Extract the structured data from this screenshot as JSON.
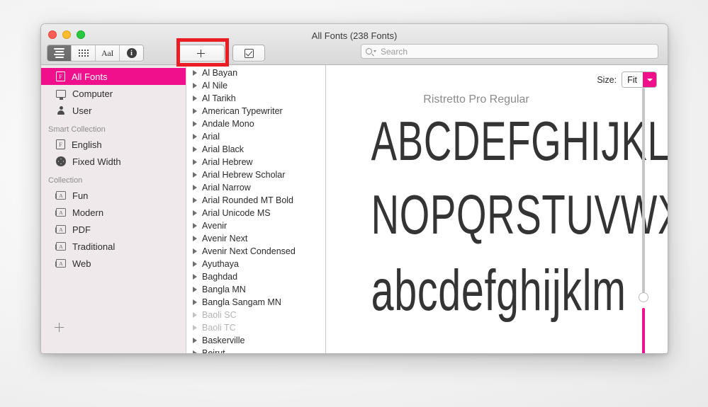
{
  "window": {
    "title": "All Fonts (238 Fonts)"
  },
  "toolbar": {
    "view_list_icon": "list-view-icon",
    "view_grid_icon": "grid-view-icon",
    "view_sample_label": "AaI",
    "info_label": "i",
    "add_label": "+",
    "validate_label": "validate-checkbox-icon"
  },
  "search": {
    "placeholder": "Search"
  },
  "sidebar": {
    "items": [
      {
        "label": "All Fonts",
        "icon": "book-icon",
        "selected": true
      },
      {
        "label": "Computer",
        "icon": "computer-icon",
        "selected": false
      },
      {
        "label": "User",
        "icon": "user-icon",
        "selected": false
      }
    ],
    "smart_collection_header": "Smart Collection",
    "smart_items": [
      {
        "label": "English",
        "icon": "book-icon"
      },
      {
        "label": "Fixed Width",
        "icon": "gear-icon"
      }
    ],
    "collection_header": "Collection",
    "collection_items": [
      {
        "label": "Fun",
        "icon": "collection-icon"
      },
      {
        "label": "Modern",
        "icon": "collection-icon"
      },
      {
        "label": "PDF",
        "icon": "collection-icon"
      },
      {
        "label": "Traditional",
        "icon": "collection-icon"
      },
      {
        "label": "Web",
        "icon": "collection-icon"
      }
    ],
    "add_label": "+"
  },
  "font_list": [
    {
      "name": "Al Bayan",
      "disabled": false
    },
    {
      "name": "Al Nile",
      "disabled": false
    },
    {
      "name": "Al Tarikh",
      "disabled": false
    },
    {
      "name": "American Typewriter",
      "disabled": false
    },
    {
      "name": "Andale Mono",
      "disabled": false
    },
    {
      "name": "Arial",
      "disabled": false
    },
    {
      "name": "Arial Black",
      "disabled": false
    },
    {
      "name": "Arial Hebrew",
      "disabled": false
    },
    {
      "name": "Arial Hebrew Scholar",
      "disabled": false
    },
    {
      "name": "Arial Narrow",
      "disabled": false
    },
    {
      "name": "Arial Rounded MT Bold",
      "disabled": false
    },
    {
      "name": "Arial Unicode MS",
      "disabled": false
    },
    {
      "name": "Avenir",
      "disabled": false
    },
    {
      "name": "Avenir Next",
      "disabled": false
    },
    {
      "name": "Avenir Next Condensed",
      "disabled": false
    },
    {
      "name": "Ayuthaya",
      "disabled": false
    },
    {
      "name": "Baghdad",
      "disabled": false
    },
    {
      "name": "Bangla MN",
      "disabled": false
    },
    {
      "name": "Bangla Sangam MN",
      "disabled": false
    },
    {
      "name": "Baoli SC",
      "disabled": true
    },
    {
      "name": "Baoli TC",
      "disabled": true
    },
    {
      "name": "Baskerville",
      "disabled": false
    },
    {
      "name": "Beirut",
      "disabled": false
    }
  ],
  "preview": {
    "size_label": "Size:",
    "size_value": "Fit",
    "font_name": "Ristretto Pro Regular",
    "line1": "ABCDEFGHIJKLM",
    "line2": "NOPQRSTUVWXYZ",
    "line3": "abcdefghijklm"
  },
  "colors": {
    "accent": "#f0108c",
    "annotation": "#ec1c24",
    "sidebar_bg": "#f0e9ec"
  }
}
